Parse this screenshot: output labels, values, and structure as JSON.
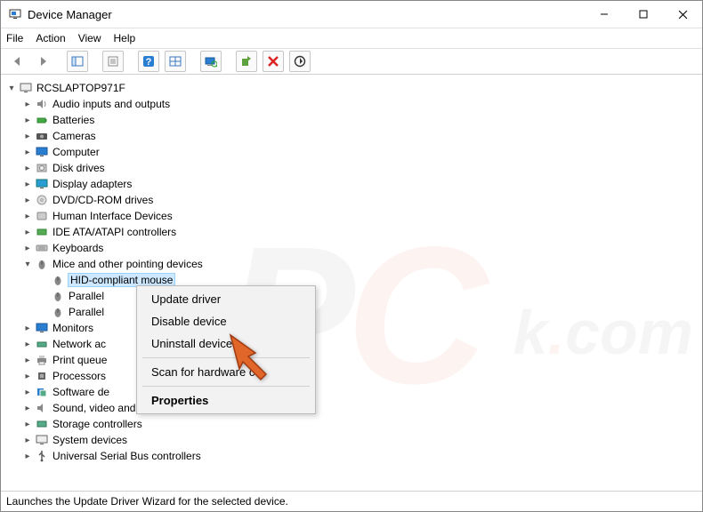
{
  "window": {
    "title": "Device Manager"
  },
  "menu": {
    "file": "File",
    "action": "Action",
    "view": "View",
    "help": "Help"
  },
  "root": {
    "label": "RCSLAPTOP971F"
  },
  "categories": [
    {
      "label": "Audio inputs and outputs"
    },
    {
      "label": "Batteries"
    },
    {
      "label": "Cameras"
    },
    {
      "label": "Computer"
    },
    {
      "label": "Disk drives"
    },
    {
      "label": "Display adapters"
    },
    {
      "label": "DVD/CD-ROM drives"
    },
    {
      "label": "Human Interface Devices"
    },
    {
      "label": "IDE ATA/ATAPI controllers"
    },
    {
      "label": "Keyboards"
    },
    {
      "label": "Mice and other pointing devices"
    },
    {
      "label": "Monitors"
    },
    {
      "label": "Network adapters",
      "truncated": "Network ac"
    },
    {
      "label": "Print queues",
      "truncated": "Print queue"
    },
    {
      "label": "Processors"
    },
    {
      "label": "Software devices",
      "truncated": "Software de"
    },
    {
      "label": "Sound, video and game controllers"
    },
    {
      "label": "Storage controllers"
    },
    {
      "label": "System devices"
    },
    {
      "label": "Universal Serial Bus controllers"
    }
  ],
  "mice_children": [
    {
      "label": "HID-compliant mouse",
      "selected": true
    },
    {
      "label": "Parallel port mouse",
      "truncated": "Parallel"
    },
    {
      "label": "Parallel port mouse",
      "truncated": "Parallel"
    }
  ],
  "context": {
    "update": "Update driver",
    "disable": "Disable device",
    "uninstall": "Uninstall device",
    "scan": "Scan for hardware changes",
    "scan_truncated": "Scan for hardware c",
    "properties": "Properties"
  },
  "status": "Launches the Update Driver Wizard for the selected device."
}
